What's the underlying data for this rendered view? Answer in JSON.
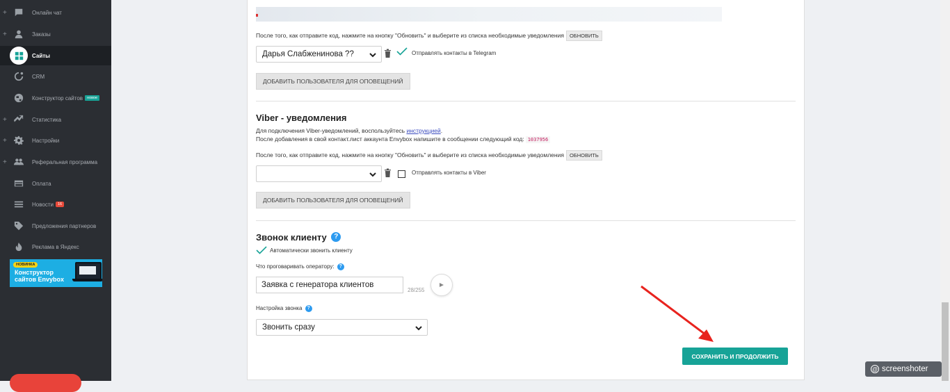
{
  "sidebar": {
    "items": [
      {
        "label": "Онлайн чат",
        "icon": "chat-icon",
        "has_plus": true
      },
      {
        "label": "Заказы",
        "icon": "user-icon",
        "has_plus": true
      },
      {
        "label": "Сайты",
        "icon": "sites-icon",
        "has_plus": false,
        "active": true
      },
      {
        "label": "CRM",
        "icon": "crm-icon",
        "has_plus": false
      },
      {
        "label": "Конструктор сайтов",
        "icon": "globe-icon",
        "has_plus": false,
        "badge": "новое"
      },
      {
        "label": "Статистика",
        "icon": "trend-icon",
        "has_plus": true
      },
      {
        "label": "Настройки",
        "icon": "gear-icon",
        "has_plus": true
      },
      {
        "label": "Реферальная программа",
        "icon": "people-icon",
        "has_plus": true
      },
      {
        "label": "Оплата",
        "icon": "card-icon",
        "has_plus": false
      },
      {
        "label": "Новости",
        "icon": "news-icon",
        "has_plus": false,
        "badge": "16"
      },
      {
        "label": "Предложения партнеров",
        "icon": "tag-icon",
        "has_plus": false
      },
      {
        "label": "Реклама в Яндекс",
        "icon": "fire-icon",
        "has_plus": false
      }
    ],
    "plus_symbol": "+",
    "promo": {
      "badge": "НОВИНКА",
      "title": "Конструктор сайтов Envybox"
    }
  },
  "telegram": {
    "refresh_hint": "После того, как отправите код, нажмите на кнопку \"Обновить\" и выберите из списка необходимые уведомления",
    "refresh_button": "ОБНОВИТЬ",
    "selected_user": "Дарья Слабженинова ??",
    "send_contacts_label": "Отправлять контакты в Telegram",
    "send_contacts_checked": true,
    "add_user_button": "ДОБАВИТЬ ПОЛЬЗОВАТЕЛЯ ДЛЯ ОПОВЕЩЕНИЙ"
  },
  "viber": {
    "title": "Viber - уведомления",
    "line1_prefix": "Для подключения Viber-уведомлений, воспользуйтесь ",
    "line1_link": "инструкцией",
    "line1_suffix": ".",
    "line2": "После добавления в свой контакт.лист аккаунта Envybox напишите в сообщении следующий код:",
    "code": "1037956",
    "refresh_hint": "После того, как отправите код, нажмите на кнопку \"Обновить\" и выберите из списка необходимые уведомления",
    "refresh_button": "ОБНОВИТЬ",
    "selected_user": "",
    "send_contacts_label": "Отправлять контакты в Viber",
    "send_contacts_checked": false,
    "add_user_button": "ДОБАВИТЬ ПОЛЬЗОВАТЕЛЯ ДЛЯ ОПОВЕЩЕНИЙ"
  },
  "callback": {
    "title": "Звонок клиенту",
    "help_symbol": "?",
    "auto_call_label": "Автоматически звонить клиенту",
    "auto_call_checked": true,
    "operator_phrase_label": "Что проговаривать оператору:",
    "operator_phrase_value": "Заявка с генератора клиентов",
    "char_counter": "28/255",
    "call_setting_label": "Настройка звонка",
    "call_setting_value": "Звонить сразу"
  },
  "save_button": "СОХРАНИТЬ И ПРОДОЛЖИТЬ",
  "watermark": {
    "symbol": "@",
    "text": "screenshoter"
  },
  "colors": {
    "accent": "#17a397",
    "sidebar_bg": "#2b2e33",
    "arrow": "#e8231e",
    "help": "#2d9bf0"
  }
}
